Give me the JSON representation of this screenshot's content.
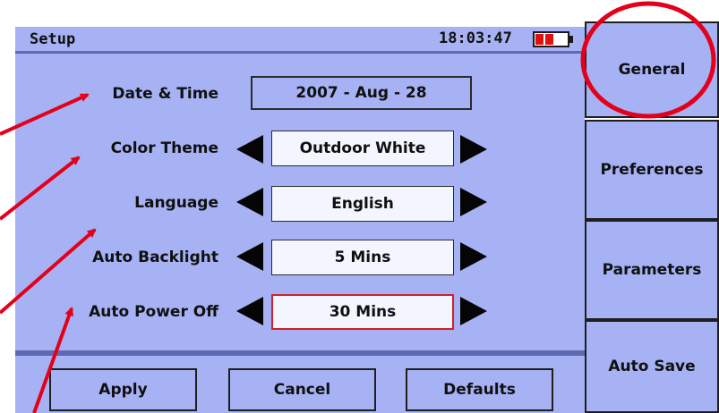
{
  "header": {
    "title": "Setup",
    "time": "18:03:47",
    "battery_color": "#e01010"
  },
  "settings": [
    {
      "label": "Date & Time",
      "value": "2007 - Aug - 28",
      "has_arrows": false,
      "selected": false
    },
    {
      "label": "Color Theme",
      "value": "Outdoor White",
      "has_arrows": true,
      "selected": false
    },
    {
      "label": "Language",
      "value": "English",
      "has_arrows": true,
      "selected": false
    },
    {
      "label": "Auto Backlight",
      "value": "5 Mins",
      "has_arrows": true,
      "selected": false
    },
    {
      "label": "Auto Power Off",
      "value": "30 Mins",
      "has_arrows": true,
      "selected": true
    }
  ],
  "buttons": {
    "apply": "Apply",
    "cancel": "Cancel",
    "defaults": "Defaults"
  },
  "tabs": [
    {
      "label": "General",
      "active": true
    },
    {
      "label": "Preferences",
      "active": false
    },
    {
      "label": "Parameters",
      "active": false
    },
    {
      "label": "Auto Save",
      "active": false
    }
  ],
  "colors": {
    "panel_background": "#a6b2f4",
    "value_box": "#f4f6ff",
    "annotation_red": "#e4001b",
    "selected_border": "#d2202a"
  },
  "icons": {
    "left_arrow": "triangle-left-icon",
    "right_arrow": "triangle-right-icon",
    "battery": "battery-icon"
  }
}
